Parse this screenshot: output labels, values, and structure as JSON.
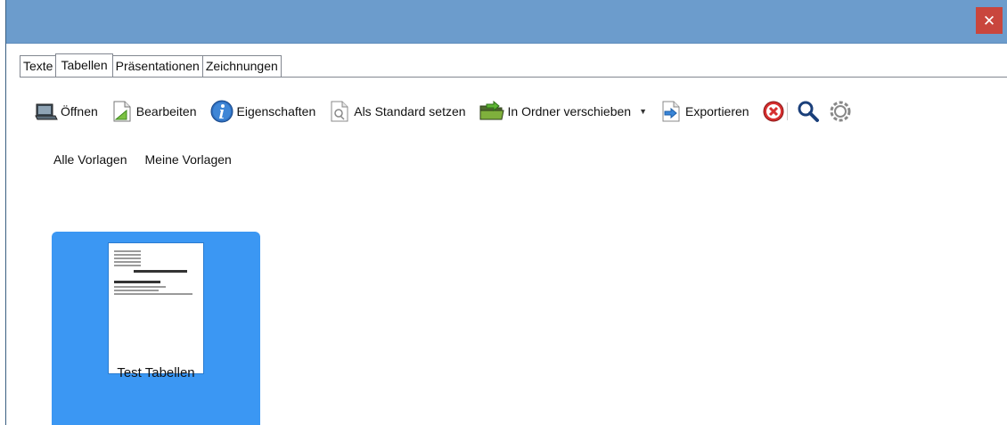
{
  "window": {
    "close_label": "✕"
  },
  "tabs": [
    {
      "label": "Texte"
    },
    {
      "label": "Tabellen"
    },
    {
      "label": "Präsentationen"
    },
    {
      "label": "Zeichnungen"
    }
  ],
  "toolbar": {
    "open_label": "Öffnen",
    "edit_label": "Bearbeiten",
    "properties_label": "Eigenschaften",
    "set_default_label": "Als Standard setzen",
    "move_label": "In Ordner verschieben",
    "export_label": "Exportieren"
  },
  "filters": {
    "all_label": "Alle Vorlagen",
    "mine_label": "Meine Vorlagen"
  },
  "templates": [
    {
      "name": "Test Tabellen",
      "selected": true
    }
  ],
  "colors": {
    "titlebar": "#6c9ccc",
    "close": "#c9463d",
    "selection": "#3b97f3"
  }
}
